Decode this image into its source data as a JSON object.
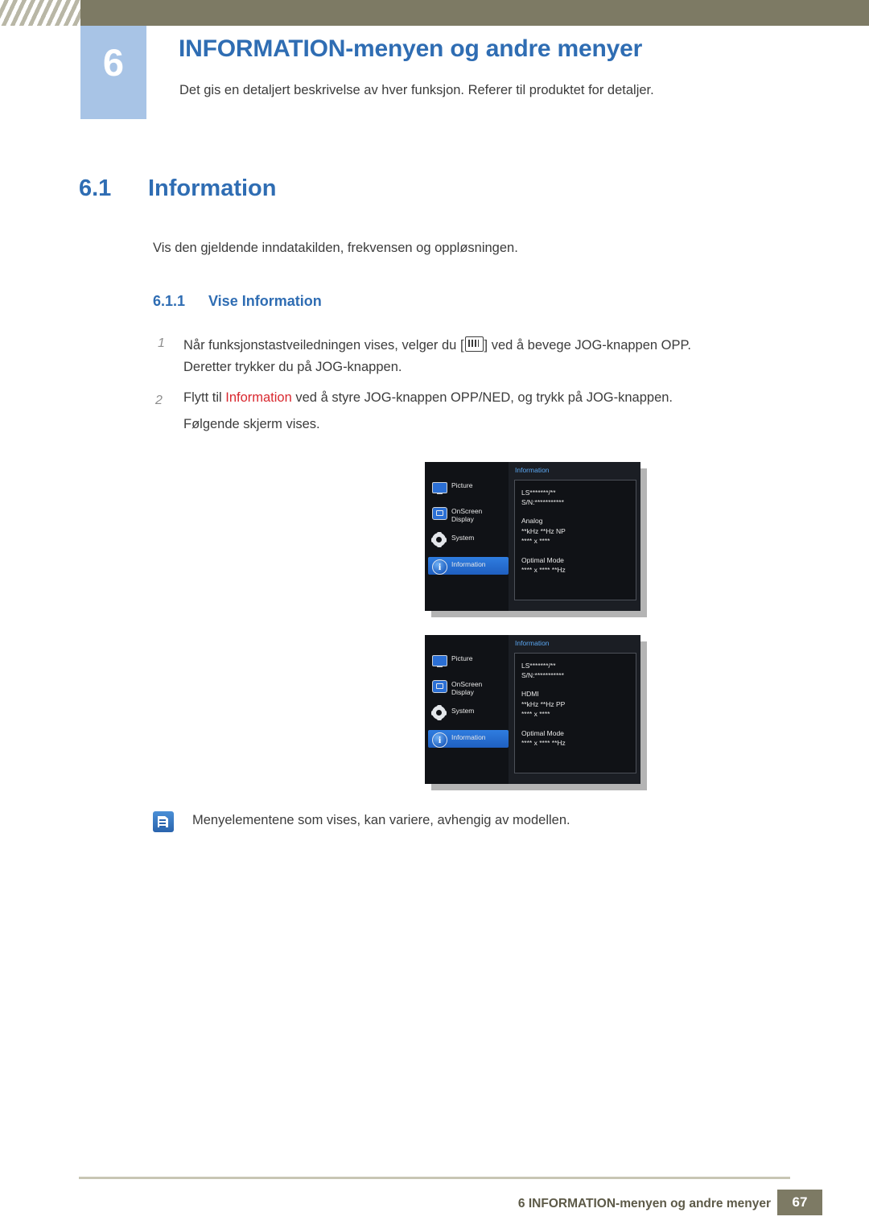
{
  "header": {
    "chapter_number": "6",
    "title": "INFORMATION-menyen og andre menyer",
    "subtitle": "Det gis en detaljert beskrivelse av hver funksjon. Referer til produktet for detaljer."
  },
  "section": {
    "number": "6.1",
    "title": "Information",
    "intro": "Vis den gjeldende inndatakilden, frekvensen og oppløsningen.",
    "sub_number": "6.1.1",
    "sub_title": "Vise Information"
  },
  "steps": [
    {
      "num": "1",
      "line1_before": "Når funksjonstastveiledningen vises, velger du [",
      "line1_after": "] ved å bevege JOG-knappen OPP.",
      "line2": "Deretter trykker du på JOG-knappen."
    },
    {
      "num": "2",
      "line1_before": "Flytt til ",
      "keyword": "Information",
      "line1_after": " ved å styre JOG-knappen OPP/NED, og trykk på JOG-knappen.",
      "line2": "Følgende skjerm vises."
    }
  ],
  "osd": [
    {
      "menu": [
        {
          "label": "Picture",
          "icon": "monitor-icon",
          "selected": false
        },
        {
          "label": "OnScreen Display",
          "icon": "osd-icon",
          "selected": false
        },
        {
          "label": "System",
          "icon": "gear-icon",
          "selected": false
        },
        {
          "label": "Information",
          "icon": "info-icon",
          "selected": true
        }
      ],
      "panel_title": "Information",
      "lines": [
        "LS*******/**",
        "S/N:***********",
        "",
        "Analog",
        "**kHz **Hz NP",
        "**** x ****",
        "",
        "Optimal Mode",
        "**** x **** **Hz"
      ]
    },
    {
      "menu": [
        {
          "label": "Picture",
          "icon": "monitor-icon",
          "selected": false
        },
        {
          "label": "OnScreen Display",
          "icon": "osd-icon",
          "selected": false
        },
        {
          "label": "System",
          "icon": "gear-icon",
          "selected": false
        },
        {
          "label": "Information",
          "icon": "info-icon",
          "selected": true
        }
      ],
      "panel_title": "Information",
      "lines": [
        "LS*******/**",
        "S/N:***********",
        "",
        "HDMI",
        "**kHz **Hz PP",
        "**** x ****",
        "",
        "Optimal Mode",
        "**** x **** **Hz"
      ]
    }
  ],
  "note": {
    "icon": "note-icon",
    "text": "Menyelementene som vises, kan variere, avhengig av modellen."
  },
  "footer": {
    "text": "6 INFORMATION-menyen og andre menyer",
    "page": "67"
  },
  "colors": {
    "accent_blue": "#2f6db3",
    "badge_blue": "#a8c4e6",
    "bar_olive": "#7d7a64",
    "keyword_red": "#d9282f"
  }
}
